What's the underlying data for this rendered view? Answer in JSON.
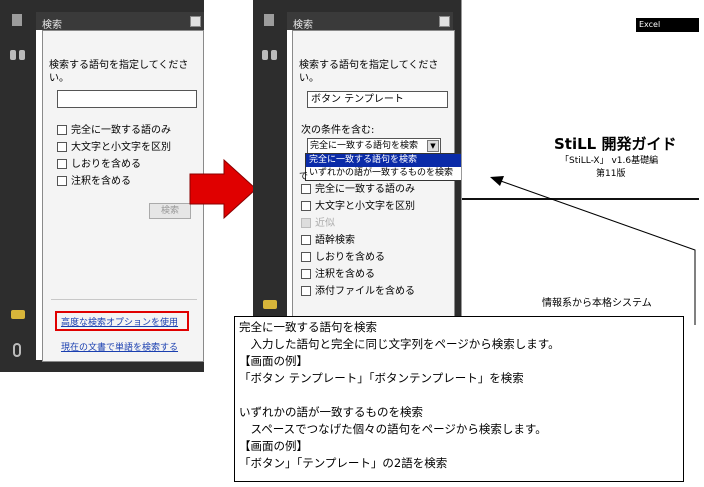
{
  "left_panel": {
    "header_title": "検索",
    "instruction": "検索する語句を指定してください。",
    "search_value": "",
    "options": [
      {
        "label": "完全に一致する語のみ",
        "checked": false
      },
      {
        "label": "大文字と小文字を区別",
        "checked": false
      },
      {
        "label": "しおりを含める",
        "checked": false
      },
      {
        "label": "注釈を含める",
        "checked": false
      }
    ],
    "search_button": "検索",
    "advanced_link": "高度な検索オプションを使用",
    "current_doc_link": "現在の文書で単語を検索する"
  },
  "right_panel": {
    "header_title": "検索",
    "instruction": "検索する語句を指定してください。",
    "search_value": "ボタン テンプレート",
    "condition_label": "次の条件を含む:",
    "condition_selected": "完全に一致する語句を検索",
    "dropdown_options": [
      "完全に一致する語句を検索",
      "いずれかの語が一致するものを検索"
    ],
    "hidden_row_prefix": "で",
    "options": [
      {
        "label": "完全に一致する語のみ",
        "disabled": false
      },
      {
        "label": "大文字と小文字を区別",
        "disabled": false
      },
      {
        "label": "近似",
        "disabled": true
      },
      {
        "label": "語幹検索",
        "disabled": false
      },
      {
        "label": "しおりを含める",
        "disabled": false
      },
      {
        "label": "注釈を含める",
        "disabled": false
      },
      {
        "label": "添付ファイルを含める",
        "disabled": false
      }
    ]
  },
  "document": {
    "badge": "Excel",
    "title": "StiLL 開発ガイド",
    "subtitle": "「StiLL-X」 v1.6基礎編",
    "edition": "第11版",
    "footer": "情報系から本格システム"
  },
  "callout": {
    "lines": [
      "完全に一致する語句を検索",
      "　入力した語句と完全に同じ文字列をページから検索します。",
      "【画面の例】",
      "「ボタン テンプレート」「ボタンテンプレート」を検索",
      "",
      "いずれかの語が一致するものを検索",
      "　スペースでつなげた個々の語句をページから検索します。",
      "【画面の例】",
      "「ボタン」「テンプレート」の2語を検索"
    ]
  },
  "colors": {
    "highlight_red": "#e00000",
    "selection_blue": "#0a2ba8",
    "dark_strip": "#2d2d2d",
    "link_blue": "#1a3fb0"
  }
}
